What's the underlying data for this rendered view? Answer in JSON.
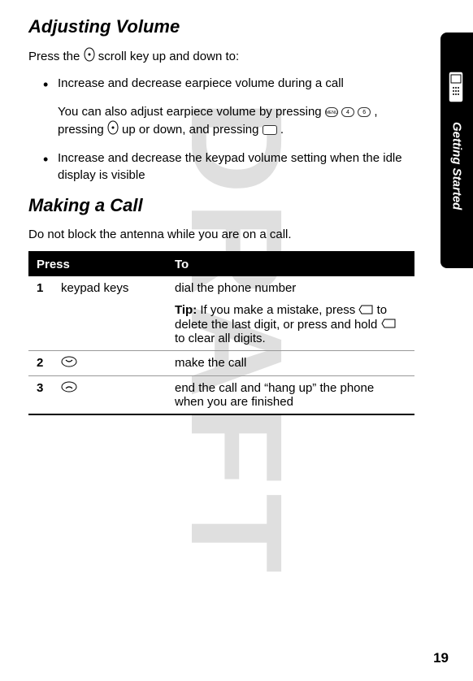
{
  "watermark": "DRAFT",
  "sidebar": {
    "label": "Getting Started"
  },
  "section1": {
    "title": "Adjusting Volume",
    "intro_before": "Press the ",
    "intro_after": " scroll key up and down to:",
    "bullets": [
      {
        "line1": "Increase and decrease earpiece volume during a call",
        "line2_a": "You can also adjust earpiece volume by pressing ",
        "line2_b": ", pressing ",
        "line2_c": " up or down, and pressing ",
        "line2_d": "."
      },
      {
        "line1": "Increase and decrease the keypad volume setting when the idle display is visible"
      }
    ]
  },
  "section2": {
    "title": "Making a Call",
    "intro": "Do not block the antenna while you are on a call.",
    "table": {
      "headers": {
        "press": "Press",
        "to": "To"
      },
      "rows": [
        {
          "num": "1",
          "press": "keypad keys",
          "to_main": "dial the phone number",
          "tip_label": "Tip:",
          "tip_text_a": " If you make a mistake, press ",
          "tip_text_b": " to delete the last digit, or press and hold ",
          "tip_text_c": " to clear all digits."
        },
        {
          "num": "2",
          "press_icon": "call-icon",
          "to_main": "make the call"
        },
        {
          "num": "3",
          "press_icon": "end-icon",
          "to_main": "end the call and “hang up” the phone when you are finished"
        }
      ]
    }
  },
  "page_number": "19",
  "icons": {
    "scroll": "scroll-key-icon",
    "menu": "MENU",
    "four": "4",
    "six": "6",
    "softkey": "soft-key-icon",
    "delete": "delete-key-icon"
  }
}
